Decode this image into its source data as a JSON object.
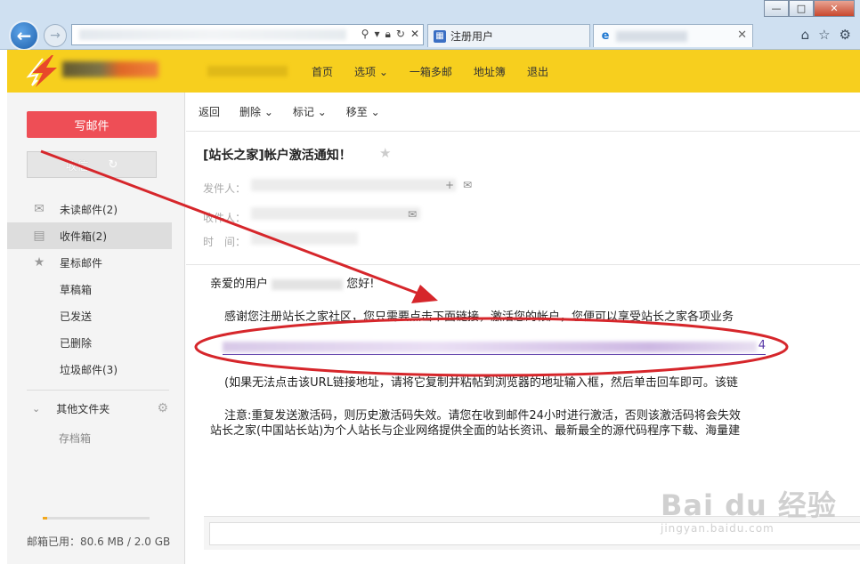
{
  "browser": {
    "tabs": [
      {
        "label": "注册用户"
      },
      {
        "label": ""
      }
    ]
  },
  "topnav": {
    "items": [
      "首页",
      "选项",
      "一箱多邮",
      "地址簿",
      "退出"
    ]
  },
  "sidebar": {
    "compose": "写邮件",
    "receive": "收信",
    "folders": [
      {
        "label": "未读邮件(2)",
        "icon": "envelope-icon"
      },
      {
        "label": "收件箱(2)",
        "icon": "inbox-icon",
        "active": true
      },
      {
        "label": "星标邮件",
        "icon": "star-icon"
      },
      {
        "label": "草稿箱"
      },
      {
        "label": "已发送"
      },
      {
        "label": "已删除"
      },
      {
        "label": "垃圾邮件(3)"
      }
    ],
    "other_folders": "其他文件夹",
    "archive": "存档箱",
    "quota_used_fraction": 0.04,
    "quota_text": "邮箱已用：80.6 MB / 2.0 GB"
  },
  "toolbar": {
    "back": "返回",
    "delete": "删除",
    "mark": "标记",
    "move": "移至"
  },
  "message": {
    "subject": "[站长之家]帐户激活通知！",
    "sender_label": "发件人：",
    "recipient_label": "收件人：",
    "time_label": "时　间：",
    "greeting_prefix": "亲爱的用户",
    "greeting_suffix": "您好!",
    "para1": "感谢您注册站长之家社区，您只需要点击下面链接，激活您的帐户，您便可以享受站长之家各项业务",
    "link_tail": "4",
    "para2": "(如果无法点击该URL链接地址，请将它复制并粘帖到浏览器的地址输入框，然后单击回车即可。该链",
    "para3": "注意:重复发送激活码，则历史激活码失效。请您在收到邮件24小时进行激活，否则该激活码将会失效",
    "para4": "站长之家(中国站长站)为个人站长与企业网络提供全面的站长资讯、最新最全的源代码程序下载、海量建"
  },
  "watermark": {
    "brand": "Bai du 经验",
    "url": "jingyan.baidu.com"
  },
  "colors": {
    "header_yellow": "#f7cf1e",
    "compose_red": "#ee4e56",
    "annotation_red": "#d6262b"
  }
}
